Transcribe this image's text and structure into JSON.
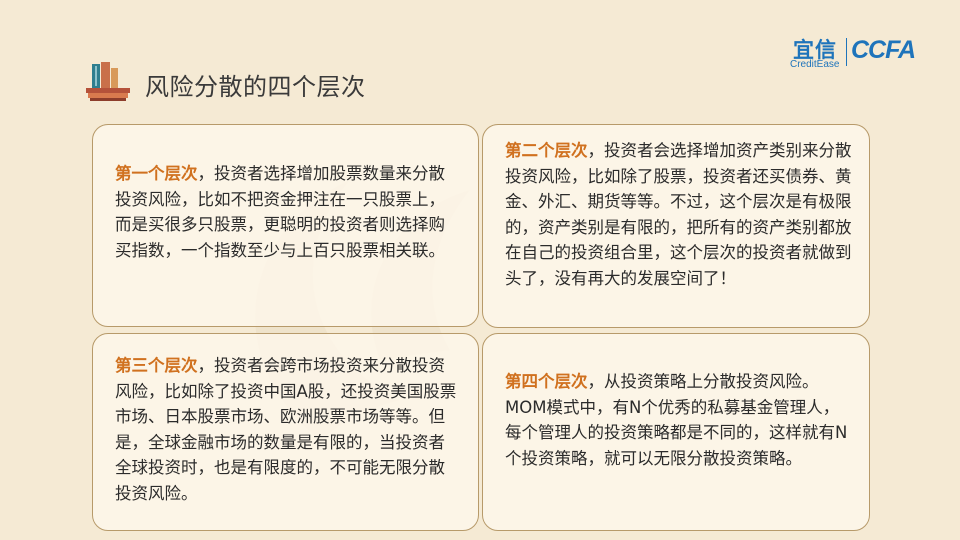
{
  "page": {
    "title": "风险分散的四个层次"
  },
  "logos": {
    "yixin_cn": "宜信",
    "yixin_en": "CreditEase",
    "ccfa": "CCFA"
  },
  "colors": {
    "background": "#f5ead4",
    "box_border": "#b79a6a",
    "lead_text": "#d0711f",
    "body_text": "#2b2b2b",
    "logo_blue": "#1e74bb"
  },
  "icons": {
    "title": "books-stack-icon"
  },
  "levels": [
    {
      "lead": "第一个层次",
      "text": "，投资者选择增加股票数量来分散投资风险，比如不把资金押注在一只股票上，而是买很多只股票，更聪明的投资者则选择购买指数，一个指数至少与上百只股票相关联。"
    },
    {
      "lead": "第二个层次",
      "text": "，投资者会选择增加资产类别来分散投资风险，比如除了股票，投资者还买债券、黄金、外汇、期货等等。不过，这个层次是有极限的，资产类别是有限的，把所有的资产类别都放在自己的投资组合里，这个层次的投资者就做到头了，没有再大的发展空间了！"
    },
    {
      "lead": "第三个层次",
      "text": "，投资者会跨市场投资来分散投资风险，比如除了投资中国A股，还投资美国股票市场、日本股票市场、欧洲股票市场等等。但是，全球金融市场的数量是有限的，当投资者全球投资时，也是有限度的，不可能无限分散投资风险。"
    },
    {
      "lead": "第四个层次",
      "text": "，从投资策略上分散投资风险。MOM模式中，有N个优秀的私募基金管理人，每个管理人的投资策略都是不同的，这样就有N个投资策略，就可以无限分散投资策略。"
    }
  ]
}
